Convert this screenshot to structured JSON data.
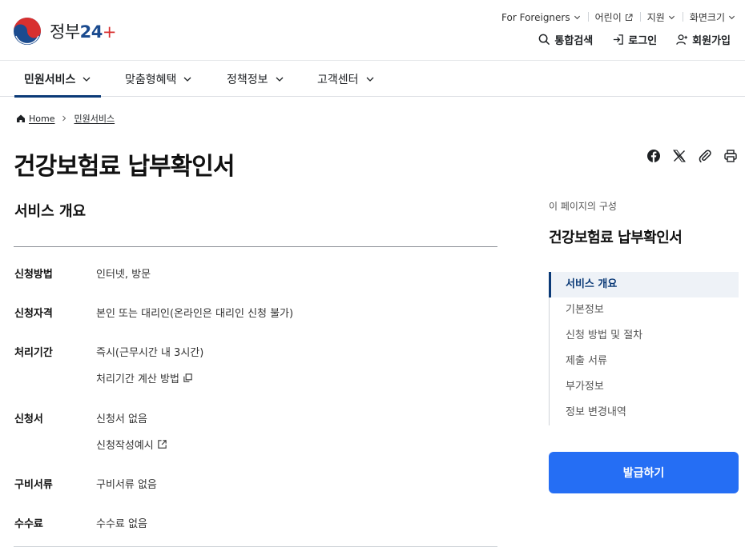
{
  "header": {
    "logo_text": "정부",
    "logo_num": "24",
    "logo_plus": "+",
    "util": {
      "foreigners": "For Foreigners",
      "kids": "어린이",
      "support": "지원",
      "text_size": "화면크기"
    },
    "main": {
      "search": "통합검색",
      "login": "로그인",
      "signup": "회원가입"
    }
  },
  "gnb": [
    {
      "label": "민원서비스"
    },
    {
      "label": "맞춤형혜택"
    },
    {
      "label": "정책정보"
    },
    {
      "label": "고객센터"
    }
  ],
  "breadcrumb": {
    "home": "Home",
    "current": "민원서비스"
  },
  "page_title": "건강보험료 납부확인서",
  "section_title": "서비스 개요",
  "rows": [
    {
      "label": "신청방법",
      "value": "인터넷, 방문"
    },
    {
      "label": "신청자격",
      "value": "본인 또는 대리인(온라인은 대리인 신청 불가)"
    },
    {
      "label": "처리기간",
      "value": "즉시(근무시간 내 3시간)",
      "link": "처리기간 계산 방법"
    },
    {
      "label": "신청서",
      "value": "신청서 없음",
      "link": "신청작성예시"
    },
    {
      "label": "구비서류",
      "value": "구비서류 없음"
    },
    {
      "label": "수수료",
      "value": "수수료 없음"
    }
  ],
  "toc": {
    "caption": "이 페이지의 구성",
    "title": "건강보험료 납부확인서",
    "items": [
      "서비스 개요",
      "기본정보",
      "신청 방법 및 절차",
      "제출 서류",
      "부가정보",
      "정보 변경내역"
    ]
  },
  "issue_button": "발급하기",
  "colors": {
    "primary": "#256ef4",
    "navy": "#0b3a77",
    "logo_red": "#d8302f",
    "logo_blue": "#1b4b8f"
  }
}
